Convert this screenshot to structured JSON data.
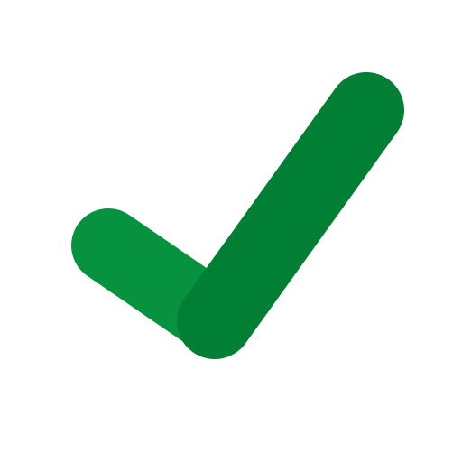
{
  "icon": {
    "name": "checkmark-icon",
    "colors": {
      "short_stroke": "#07923F",
      "long_stroke": "#017F35",
      "background": "#FFFFFF"
    }
  }
}
